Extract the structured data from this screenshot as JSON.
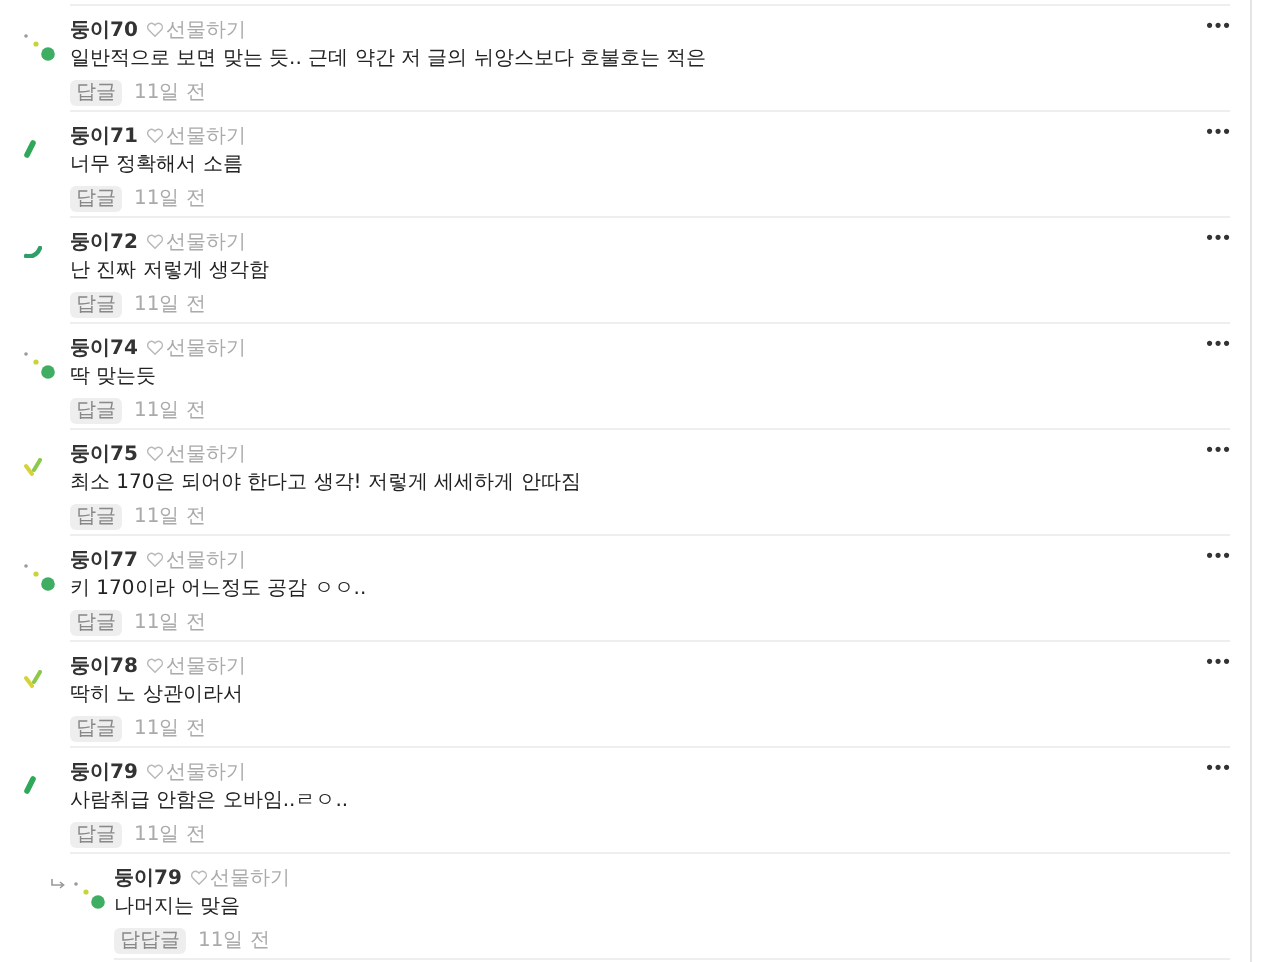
{
  "comments": [
    {
      "kind": "dot",
      "author": "둥이70",
      "gift": "선물하기",
      "text": "일반적으로 보면 맞는 듯.. 근데 약간 저 글의 뉘앙스보다 호불호는 적은",
      "reply": "답글",
      "time": "11일 전",
      "more": "•••"
    },
    {
      "kind": "stick",
      "author": "둥이71",
      "gift": "선물하기",
      "text": "너무 정확해서 소름",
      "reply": "답글",
      "time": "11일 전",
      "more": "•••"
    },
    {
      "kind": "arc",
      "author": "둥이72",
      "gift": "선물하기",
      "text": "난 진짜 저렇게 생각함",
      "reply": "답글",
      "time": "11일 전",
      "more": "•••"
    },
    {
      "kind": "dot",
      "author": "둥이74",
      "gift": "선물하기",
      "text": "딱 맞는듯",
      "reply": "답글",
      "time": "11일 전",
      "more": "•••"
    },
    {
      "kind": "check",
      "author": "둥이75",
      "gift": "선물하기",
      "text": "최소 170은 되어야 한다고 생각! 저렇게 세세하게 안따짐",
      "reply": "답글",
      "time": "11일 전",
      "more": "•••"
    },
    {
      "kind": "dot",
      "author": "둥이77",
      "gift": "선물하기",
      "text": "키 170이라 어느정도 공감 ㅇㅇ..",
      "reply": "답글",
      "time": "11일 전",
      "more": "•••"
    },
    {
      "kind": "check",
      "author": "둥이78",
      "gift": "선물하기",
      "text": "딱히 노 상관이라서",
      "reply": "답글",
      "time": "11일 전",
      "more": "•••"
    },
    {
      "kind": "stick",
      "author": "둥이79",
      "gift": "선물하기",
      "text": "사람취급 안함은 오바임..ㄹㅇ..",
      "reply": "답글",
      "time": "11일 전",
      "more": "•••",
      "children": [
        {
          "kind": "dot",
          "author": "둥이79",
          "gift": "선물하기",
          "text": "나머지는 맞음",
          "reply": "답답글",
          "time": "11일 전"
        }
      ]
    }
  ]
}
